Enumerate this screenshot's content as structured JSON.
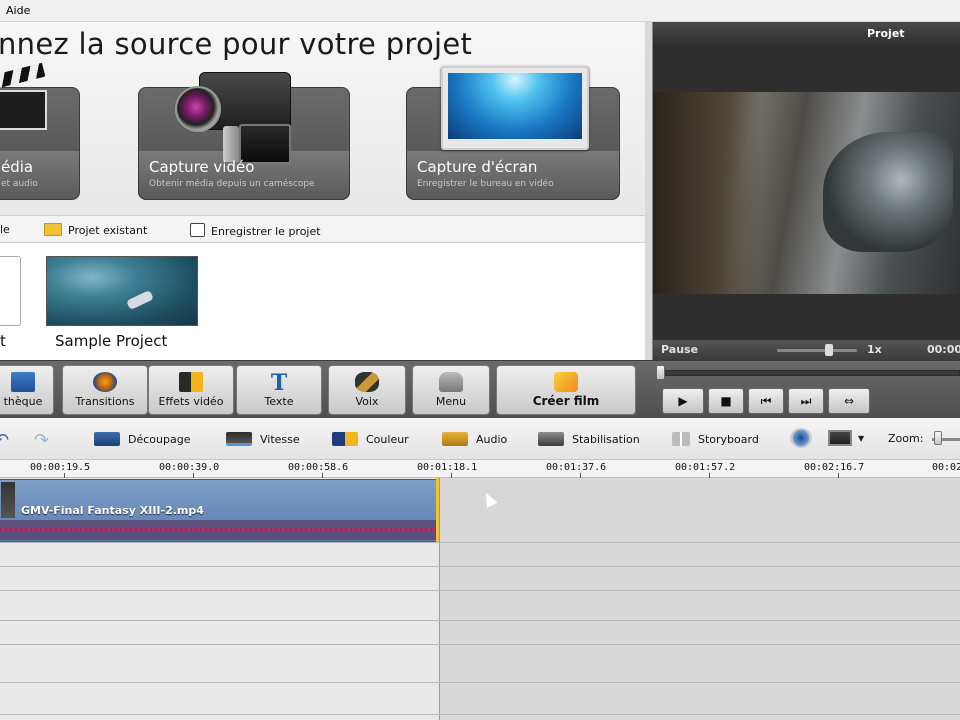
{
  "menubar": {
    "help": "Aide"
  },
  "source": {
    "title": "nnez la source pour votre projet",
    "cards": [
      {
        "label": "édia",
        "sub": "et audio",
        "icon": "clapperboard-icon"
      },
      {
        "label": "Capture vidéo",
        "sub": "Obtenir média depuis un caméscope",
        "icon": "camcorder-icon"
      },
      {
        "label": "Capture d'écran",
        "sub": "Enregistrer le bureau en vidéo",
        "icon": "monitor-icon"
      }
    ]
  },
  "project_toolbar": {
    "new_fragment": "le",
    "existing": "Projet existant",
    "save": "Enregistrer le projet"
  },
  "projects": {
    "blank_label": "t",
    "sample_label": "Sample Project"
  },
  "preview": {
    "title": "Projet",
    "status": "Pause",
    "speed": "1x",
    "time": "00:00"
  },
  "main_toolbar": {
    "library": "thèque",
    "transitions": "Transitions",
    "effects": "Effets vidéo",
    "text": "Texte",
    "text_icon_glyph": "T",
    "voice": "Voix",
    "menu": "Menu",
    "create": "Créer film"
  },
  "transport": {
    "play": "▶",
    "stop": "■",
    "prev": "⏮",
    "next": "⏭",
    "fullscreen": "⇔"
  },
  "edit_toolbar": {
    "undo": "↶",
    "redo": "↷",
    "cut": "Découpage",
    "speed": "Vitesse",
    "color": "Couleur",
    "audio": "Audio",
    "stabilization": "Stabilisation",
    "storyboard": "Storyboard",
    "zoom": "Zoom:",
    "dropdown_glyph": "▼"
  },
  "ruler": {
    "ticks": [
      "00:00:19.5",
      "00:00:39.0",
      "00:00:58.6",
      "00:01:18.1",
      "00:01:37.6",
      "00:01:57.2",
      "00:02:16.7",
      "00:02"
    ]
  },
  "timeline": {
    "clip_name": "GMV-Final Fantasy XIII-2.mp4"
  },
  "colors": {
    "clip_blue": "#5b7fb0",
    "playhead": "#f2c230",
    "audio_wave": "#b03060"
  }
}
